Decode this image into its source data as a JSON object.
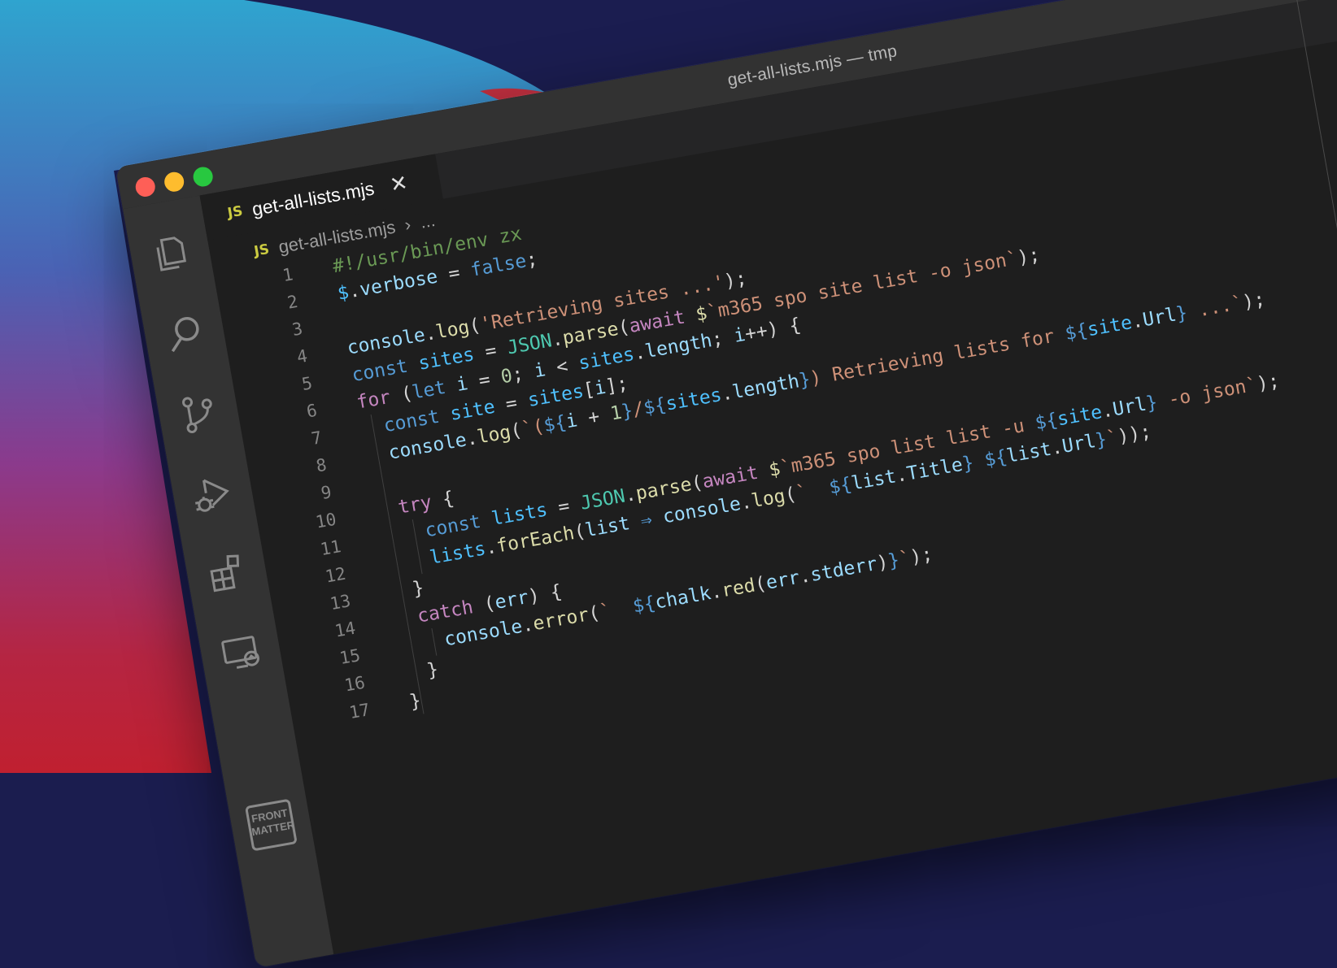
{
  "window": {
    "title": "get-all-lists.mjs — tmp"
  },
  "activity_bar": {
    "icons": [
      "files-icon",
      "search-icon",
      "source-control-icon",
      "run-debug-icon",
      "extensions-icon",
      "remote-explorer-icon"
    ],
    "front_matter_logo": [
      "FRONT",
      "MATTER"
    ]
  },
  "tabs": [
    {
      "badge": "JS",
      "label": "get-all-lists.mjs",
      "close": "✕",
      "active": true
    }
  ],
  "breadcrumb": {
    "badge": "JS",
    "file": "get-all-lists.mjs",
    "separator": "›",
    "more": "..."
  },
  "editor": {
    "line_numbers": [
      "1",
      "2",
      "3",
      "4",
      "5",
      "6",
      "7",
      "8",
      "9",
      "10",
      "11",
      "12",
      "13",
      "14",
      "15",
      "16",
      "17"
    ],
    "lines": [
      [
        {
          "t": "#!/usr/bin/env zx",
          "c": "com"
        }
      ],
      [
        {
          "t": "$",
          "c": "const"
        },
        {
          "t": ".",
          "c": "p"
        },
        {
          "t": "verbose",
          "c": "var"
        },
        {
          "t": " = ",
          "c": "p"
        },
        {
          "t": "false",
          "c": "kw"
        },
        {
          "t": ";",
          "c": "p"
        }
      ],
      [],
      [
        {
          "t": "console",
          "c": "var"
        },
        {
          "t": ".",
          "c": "p"
        },
        {
          "t": "log",
          "c": "fn"
        },
        {
          "t": "(",
          "c": "p"
        },
        {
          "t": "'Retrieving sites ...'",
          "c": "str"
        },
        {
          "t": ");",
          "c": "p"
        }
      ],
      [
        {
          "t": "const ",
          "c": "kw"
        },
        {
          "t": "sites",
          "c": "const"
        },
        {
          "t": " = ",
          "c": "p"
        },
        {
          "t": "JSON",
          "c": "cls"
        },
        {
          "t": ".",
          "c": "p"
        },
        {
          "t": "parse",
          "c": "fn"
        },
        {
          "t": "(",
          "c": "p"
        },
        {
          "t": "await ",
          "c": "ctl"
        },
        {
          "t": "$",
          "c": "fn"
        },
        {
          "t": "`m365 spo site list -o json`",
          "c": "str"
        },
        {
          "t": ");",
          "c": "p"
        }
      ],
      [
        {
          "t": "for ",
          "c": "ctl"
        },
        {
          "t": "(",
          "c": "p"
        },
        {
          "t": "let ",
          "c": "kw"
        },
        {
          "t": "i",
          "c": "var"
        },
        {
          "t": " = ",
          "c": "p"
        },
        {
          "t": "0",
          "c": "num"
        },
        {
          "t": "; ",
          "c": "p"
        },
        {
          "t": "i",
          "c": "var"
        },
        {
          "t": " < ",
          "c": "p"
        },
        {
          "t": "sites",
          "c": "const"
        },
        {
          "t": ".",
          "c": "p"
        },
        {
          "t": "length",
          "c": "var"
        },
        {
          "t": "; ",
          "c": "p"
        },
        {
          "t": "i",
          "c": "var"
        },
        {
          "t": "++) {",
          "c": "p"
        }
      ],
      [
        {
          "t": "  const ",
          "c": "kw"
        },
        {
          "t": "site",
          "c": "const"
        },
        {
          "t": " = ",
          "c": "p"
        },
        {
          "t": "sites",
          "c": "const"
        },
        {
          "t": "[",
          "c": "p"
        },
        {
          "t": "i",
          "c": "var"
        },
        {
          "t": "];",
          "c": "p"
        }
      ],
      [
        {
          "t": "  console",
          "c": "var"
        },
        {
          "t": ".",
          "c": "p"
        },
        {
          "t": "log",
          "c": "fn"
        },
        {
          "t": "(",
          "c": "p"
        },
        {
          "t": "`(",
          "c": "str"
        },
        {
          "t": "${",
          "c": "tpl"
        },
        {
          "t": "i",
          "c": "var"
        },
        {
          "t": " + ",
          "c": "p"
        },
        {
          "t": "1",
          "c": "num"
        },
        {
          "t": "}",
          "c": "tpl"
        },
        {
          "t": "/",
          "c": "str"
        },
        {
          "t": "${",
          "c": "tpl"
        },
        {
          "t": "sites",
          "c": "const"
        },
        {
          "t": ".",
          "c": "p"
        },
        {
          "t": "length",
          "c": "var"
        },
        {
          "t": "}",
          "c": "tpl"
        },
        {
          "t": ") Retrieving lists for ",
          "c": "str"
        },
        {
          "t": "${",
          "c": "tpl"
        },
        {
          "t": "site",
          "c": "const"
        },
        {
          "t": ".",
          "c": "p"
        },
        {
          "t": "Url",
          "c": "var"
        },
        {
          "t": "}",
          "c": "tpl"
        },
        {
          "t": " ...`",
          "c": "str"
        },
        {
          "t": ");",
          "c": "p"
        }
      ],
      [],
      [
        {
          "t": "  try ",
          "c": "ctl"
        },
        {
          "t": "{",
          "c": "p"
        }
      ],
      [
        {
          "t": "    const ",
          "c": "kw"
        },
        {
          "t": "lists",
          "c": "const"
        },
        {
          "t": " = ",
          "c": "p"
        },
        {
          "t": "JSON",
          "c": "cls"
        },
        {
          "t": ".",
          "c": "p"
        },
        {
          "t": "parse",
          "c": "fn"
        },
        {
          "t": "(",
          "c": "p"
        },
        {
          "t": "await ",
          "c": "ctl"
        },
        {
          "t": "$",
          "c": "fn"
        },
        {
          "t": "`m365 spo list list -u ",
          "c": "str"
        },
        {
          "t": "${",
          "c": "tpl"
        },
        {
          "t": "site",
          "c": "const"
        },
        {
          "t": ".",
          "c": "p"
        },
        {
          "t": "Url",
          "c": "var"
        },
        {
          "t": "}",
          "c": "tpl"
        },
        {
          "t": " -o json`",
          "c": "str"
        },
        {
          "t": ");",
          "c": "p"
        }
      ],
      [
        {
          "t": "    lists",
          "c": "const"
        },
        {
          "t": ".",
          "c": "p"
        },
        {
          "t": "forEach",
          "c": "fn"
        },
        {
          "t": "(",
          "c": "p"
        },
        {
          "t": "list",
          "c": "var"
        },
        {
          "t": " ⇒ ",
          "c": "kw"
        },
        {
          "t": "console",
          "c": "var"
        },
        {
          "t": ".",
          "c": "p"
        },
        {
          "t": "log",
          "c": "fn"
        },
        {
          "t": "(",
          "c": "p"
        },
        {
          "t": "`  ",
          "c": "str"
        },
        {
          "t": "${",
          "c": "tpl"
        },
        {
          "t": "list",
          "c": "var"
        },
        {
          "t": ".",
          "c": "p"
        },
        {
          "t": "Title",
          "c": "var"
        },
        {
          "t": "}",
          "c": "tpl"
        },
        {
          "t": " ",
          "c": "str"
        },
        {
          "t": "${",
          "c": "tpl"
        },
        {
          "t": "list",
          "c": "var"
        },
        {
          "t": ".",
          "c": "p"
        },
        {
          "t": "Url",
          "c": "var"
        },
        {
          "t": "}",
          "c": "tpl"
        },
        {
          "t": "`",
          "c": "str"
        },
        {
          "t": "));",
          "c": "p"
        }
      ],
      [
        {
          "t": "  }",
          "c": "p"
        }
      ],
      [
        {
          "t": "  catch ",
          "c": "ctl"
        },
        {
          "t": "(",
          "c": "p"
        },
        {
          "t": "err",
          "c": "var"
        },
        {
          "t": ") {",
          "c": "p"
        }
      ],
      [
        {
          "t": "    console",
          "c": "var"
        },
        {
          "t": ".",
          "c": "p"
        },
        {
          "t": "error",
          "c": "fn"
        },
        {
          "t": "(",
          "c": "p"
        },
        {
          "t": "`  ",
          "c": "str"
        },
        {
          "t": "${",
          "c": "tpl"
        },
        {
          "t": "chalk",
          "c": "var"
        },
        {
          "t": ".",
          "c": "p"
        },
        {
          "t": "red",
          "c": "fn"
        },
        {
          "t": "(",
          "c": "p"
        },
        {
          "t": "err",
          "c": "var"
        },
        {
          "t": ".",
          "c": "p"
        },
        {
          "t": "stderr",
          "c": "var"
        },
        {
          "t": ")",
          "c": "p"
        },
        {
          "t": "}",
          "c": "tpl"
        },
        {
          "t": "`",
          "c": "str"
        },
        {
          "t": ");",
          "c": "p"
        }
      ],
      [
        {
          "t": "  }",
          "c": "p"
        }
      ],
      [
        {
          "t": "}",
          "c": "p"
        }
      ]
    ]
  },
  "colors": {
    "window_bg": "#1e1e1e",
    "titlebar": "#323232",
    "activity_bar": "#333333",
    "comment": "#6a9955",
    "keyword": "#569cd6",
    "control": "#c586c0",
    "variable": "#9cdcfe",
    "function": "#dcdcaa",
    "class": "#4ec9b0",
    "string": "#ce9178",
    "number": "#b5cea8"
  }
}
